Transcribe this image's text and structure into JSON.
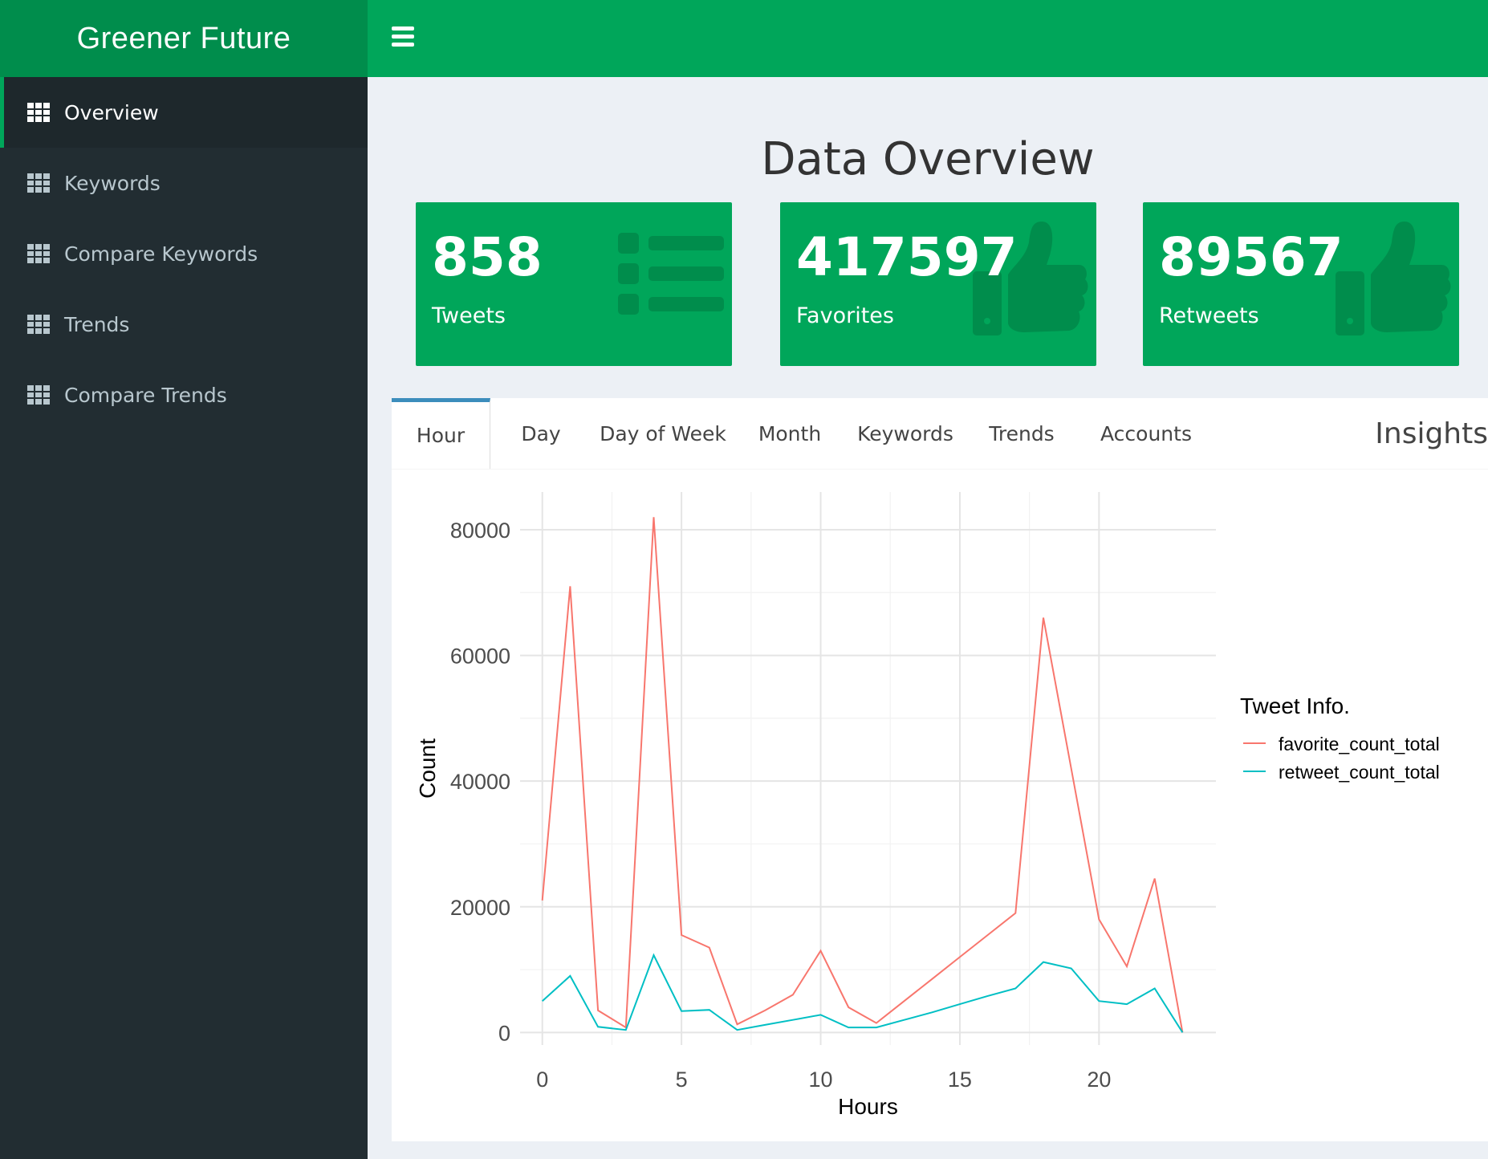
{
  "brand": "Greener Future",
  "sidebar": {
    "items": [
      {
        "label": "Overview",
        "active": true
      },
      {
        "label": "Keywords"
      },
      {
        "label": "Compare Keywords"
      },
      {
        "label": "Trends"
      },
      {
        "label": "Compare Trends"
      }
    ]
  },
  "page_title": "Data Overview",
  "value_boxes": [
    {
      "value": "858",
      "label": "Tweets",
      "icon": "list-icon"
    },
    {
      "value": "417597",
      "label": "Favorites",
      "icon": "thumbs-up-icon"
    },
    {
      "value": "89567",
      "label": "Retweets",
      "icon": "thumbs-up-icon"
    }
  ],
  "tabs": [
    "Hour",
    "Day",
    "Day of Week",
    "Month",
    "Keywords",
    "Trends",
    "Accounts"
  ],
  "tabs_title": "Insights",
  "colors": {
    "green": "#00a65a",
    "dark_green": "#008d4c",
    "sidebar": "#222d32",
    "favorite": "#F8766D",
    "retweet": "#00BFC4"
  },
  "chart_data": {
    "type": "line",
    "xlabel": "Hours",
    "ylabel": "Count",
    "xlim": [
      -0.8,
      24.2
    ],
    "ylim": [
      -2000,
      86000
    ],
    "xticks": [
      0,
      5,
      10,
      15,
      20
    ],
    "yticks": [
      0,
      20000,
      40000,
      60000,
      80000
    ],
    "legend_title": "Tweet Info.",
    "legend_position": "right",
    "grid": true,
    "x": [
      0,
      1,
      2,
      3,
      4,
      5,
      6,
      7,
      8,
      9,
      10,
      11,
      12,
      13,
      14,
      15,
      16,
      17,
      18,
      19,
      20,
      21,
      22,
      23
    ],
    "series": [
      {
        "name": "favorite_count_total",
        "color": "#F8766D",
        "values": [
          21000,
          71000,
          3500,
          800,
          82000,
          15500,
          13500,
          1300,
          3500,
          6000,
          13000,
          4000,
          1500,
          5000,
          8500,
          12000,
          15500,
          19000,
          66000,
          42000,
          18000,
          10500,
          24500,
          0
        ]
      },
      {
        "name": "retweet_count_total",
        "color": "#00BFC4",
        "values": [
          5000,
          9000,
          900,
          400,
          12300,
          3400,
          3600,
          400,
          1200,
          2000,
          2800,
          800,
          800,
          2000,
          3200,
          4500,
          5800,
          7000,
          11200,
          10200,
          5000,
          4500,
          7000,
          0
        ]
      }
    ]
  }
}
